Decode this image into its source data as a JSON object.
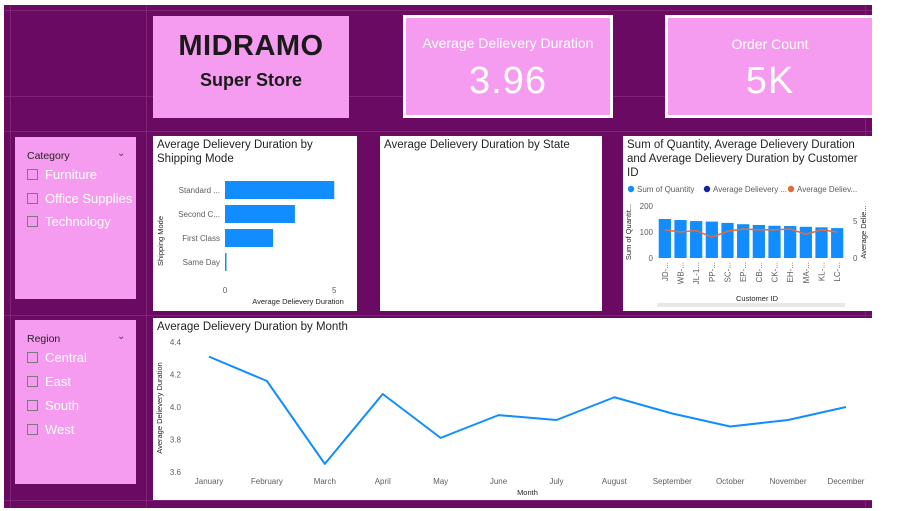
{
  "header": {
    "brand": "MIDRAMO",
    "subtitle": "Super Store"
  },
  "kpis": [
    {
      "label": "Average Delievery Duration",
      "value": "3.96"
    },
    {
      "label": "Order Count",
      "value": "5K"
    }
  ],
  "slicers": {
    "category": {
      "title": "Category",
      "items": [
        "Furniture",
        "Office Supplies",
        "Technology"
      ]
    },
    "region": {
      "title": "Region",
      "items": [
        "Central",
        "East",
        "South",
        "West"
      ]
    }
  },
  "charts": {
    "shipping": {
      "title": "Average Delievery Duration by Shipping Mode"
    },
    "state": {
      "title": "Average Delievery Duration by State"
    },
    "customer": {
      "title": "Sum of Quantity, Average Delievery Duration and Average Delievery Duration by Customer ID"
    },
    "month": {
      "title": "Average Delievery Duration by Month"
    }
  },
  "colors": {
    "accent": "#118dff",
    "navy": "#12239e",
    "orange": "#e66c37",
    "background": "#6b0a63",
    "card": "#f59cf0"
  },
  "chart_data": [
    {
      "type": "bar",
      "orientation": "horizontal",
      "title": "Average Delievery Duration by Shipping Mode",
      "categories": [
        "Standard ...",
        "Second C...",
        "First Class",
        "Same Day"
      ],
      "values": [
        5.0,
        3.2,
        2.2,
        0.04
      ],
      "xlabel": "Average Delievery Duration",
      "ylabel": "Shipping Mode",
      "xticks": [
        "0",
        "5"
      ],
      "xlim": [
        0,
        5.4
      ]
    },
    {
      "type": "bar",
      "title": "Average Delievery Duration by State",
      "categories": [],
      "values": []
    },
    {
      "type": "bar",
      "title": "Sum of Quantity, Average Delievery Duration and Average Delievery Duration by Customer ID",
      "legend": [
        "Sum of Quantity",
        "Average Delievery ...",
        "Average Deliev..."
      ],
      "categories": [
        "JD-...",
        "WB-...",
        "JL-1...",
        "PP-...",
        "SC-...",
        "EP-...",
        "CB-...",
        "CK-...",
        "EH-...",
        "MA-...",
        "KL-...",
        "LC-..."
      ],
      "series": [
        {
          "name": "Sum of Quantity",
          "values": [
            150,
            146,
            142,
            140,
            135,
            130,
            127,
            124,
            123,
            120,
            118,
            115
          ]
        },
        {
          "name": "Average Deliev...",
          "values": [
            3.8,
            3.5,
            3.7,
            2.8,
            3.6,
            3.9,
            3.8,
            3.8,
            3.9,
            3.2,
            3.8,
            3.5
          ]
        }
      ],
      "xlabel": "Customer ID",
      "ylabel": "Sum of Quantit...",
      "y2label": "Average Delie...",
      "yticks": [
        "0",
        "100",
        "200"
      ],
      "ylim": [
        0,
        200
      ],
      "y2ticks": [
        "0",
        "5"
      ],
      "y2lim": [
        0,
        7
      ]
    },
    {
      "type": "line",
      "title": "Average Delievery Duration by Month",
      "categories": [
        "January",
        "February",
        "March",
        "April",
        "May",
        "June",
        "July",
        "August",
        "September",
        "October",
        "November",
        "December"
      ],
      "values": [
        4.31,
        4.16,
        3.65,
        4.08,
        3.81,
        3.95,
        3.92,
        4.06,
        3.96,
        3.88,
        3.92,
        4.0
      ],
      "xlabel": "Month",
      "ylabel": "Average Delievery Duration",
      "yticks": [
        "3.6",
        "3.8",
        "4.0",
        "4.2",
        "4.4"
      ],
      "ylim": [
        3.6,
        4.4
      ]
    }
  ]
}
